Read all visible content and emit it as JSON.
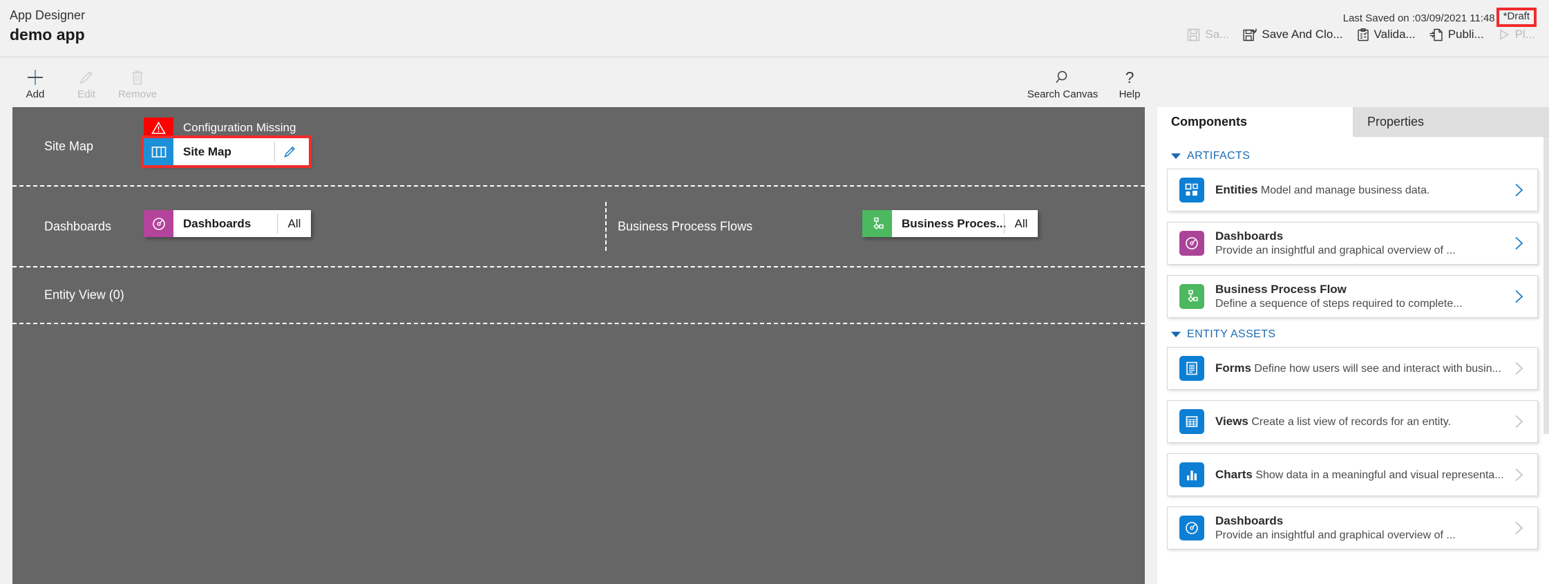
{
  "header": {
    "app_designer_label": "App Designer",
    "app_name": "demo app",
    "last_saved": "Last Saved on :03/09/2021 11:48",
    "draft_badge": "*Draft",
    "actions": [
      {
        "label": "Sa...",
        "icon": "save-icon",
        "disabled": true
      },
      {
        "label": "Save And Clo...",
        "icon": "save-and-close-icon",
        "disabled": false
      },
      {
        "label": "Valida...",
        "icon": "validate-icon",
        "disabled": false
      },
      {
        "label": "Publi...",
        "icon": "publish-icon",
        "disabled": false
      },
      {
        "label": "Pl...",
        "icon": "play-icon",
        "disabled": true
      }
    ]
  },
  "ribbon": {
    "left_buttons": [
      {
        "label": "Add",
        "icon": "plus-icon",
        "disabled": false
      },
      {
        "label": "Edit",
        "icon": "pencil-icon",
        "disabled": true
      },
      {
        "label": "Remove",
        "icon": "trash-icon",
        "disabled": true
      }
    ],
    "right_buttons": [
      {
        "label": "Search Canvas",
        "icon": "search-icon",
        "disabled": false
      },
      {
        "label": "Help",
        "icon": "question-mark-icon",
        "disabled": false
      }
    ]
  },
  "canvas": {
    "rows": [
      {
        "label": "Site Map",
        "warning": "Configuration Missing",
        "tile": {
          "name": "Site Map",
          "icon": "sitemap-icon",
          "icon_color": "#1e90d8",
          "edit": true,
          "selected": true
        }
      },
      {
        "label": "Dashboards",
        "tile": {
          "name": "Dashboards",
          "icon": "dashboard-gauge-icon",
          "icon_color": "#b4449b",
          "filter": "All",
          "selected": false
        }
      },
      {
        "label": "Business Process Flows",
        "tile": {
          "name": "Business Proces...",
          "icon": "process-flow-icon",
          "icon_color": "#4cb860",
          "filter": "All",
          "selected": false
        }
      },
      {
        "label": "Entity View (0)"
      }
    ]
  },
  "right_panel": {
    "tabs": [
      {
        "label": "Components",
        "active": true
      },
      {
        "label": "Properties",
        "active": false
      }
    ],
    "sections": [
      {
        "title": "ARTIFACTS",
        "cards": [
          {
            "title": "Entities",
            "desc": "Model and manage business data.",
            "icon": "entities-grid-icon",
            "icon_class": "ic-blue",
            "chevron_enabled": true
          },
          {
            "title": "Dashboards",
            "desc": "Provide an insightful and graphical overview of ...",
            "icon": "dashboard-gauge-icon",
            "icon_class": "ic-purple",
            "chevron_enabled": true
          },
          {
            "title": "Business Process Flow",
            "desc": "Define a sequence of steps required to complete...",
            "icon": "process-flow-icon",
            "icon_class": "ic-green",
            "chevron_enabled": true
          }
        ]
      },
      {
        "title": "ENTITY ASSETS",
        "cards": [
          {
            "title": "Forms",
            "desc": "Define how users will see and interact with busin...",
            "icon": "form-document-icon",
            "icon_class": "ic-blue",
            "chevron_enabled": false
          },
          {
            "title": "Views",
            "desc": "Create a list view of records for an entity.",
            "icon": "views-table-icon",
            "icon_class": "ic-blue",
            "chevron_enabled": false
          },
          {
            "title": "Charts",
            "desc": "Show data in a meaningful and visual representa...",
            "icon": "bar-chart-icon",
            "icon_class": "ic-blue",
            "chevron_enabled": false
          },
          {
            "title": "Dashboards",
            "desc": "Provide an insightful and graphical overview of ...",
            "icon": "dashboard-gauge-icon",
            "icon_class": "ic-blue",
            "chevron_enabled": false
          }
        ]
      }
    ]
  },
  "colors": {
    "warning_red": "#ff0000",
    "highlight_red": "#f12b2b",
    "canvas_gray": "#666666",
    "accent_blue": "#1a6bb5"
  }
}
